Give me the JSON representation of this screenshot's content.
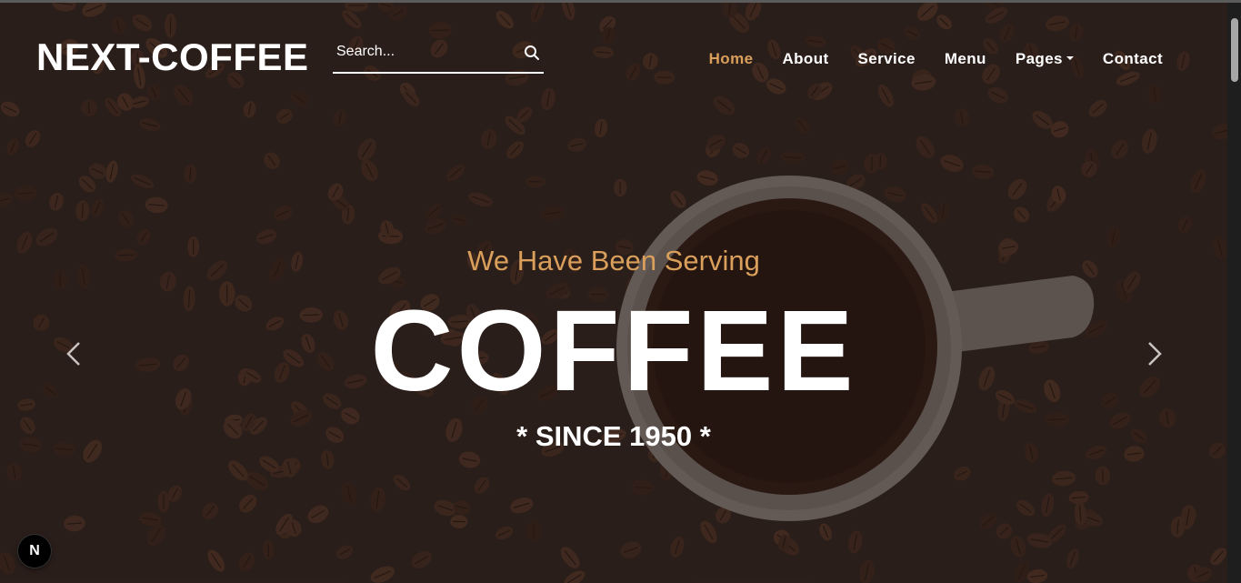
{
  "header": {
    "brand": "NEXT-COFFEE",
    "search": {
      "placeholder": "Search...",
      "icon": "search-icon"
    },
    "nav": [
      {
        "label": "Home",
        "active": true
      },
      {
        "label": "About",
        "active": false
      },
      {
        "label": "Service",
        "active": false
      },
      {
        "label": "Menu",
        "active": false
      },
      {
        "label": "Pages",
        "active": false,
        "dropdown": true
      },
      {
        "label": "Contact",
        "active": false
      }
    ]
  },
  "hero": {
    "eyebrow": "We Have Been Serving",
    "title": "COFFEE",
    "subtitle": "* SINCE 1950 *",
    "prev_icon": "chevron-left-icon",
    "next_icon": "chevron-right-icon"
  },
  "badge": {
    "label": "N"
  },
  "colors": {
    "accent": "#da9f5b",
    "text": "#ffffff",
    "overlay": "#211614"
  }
}
